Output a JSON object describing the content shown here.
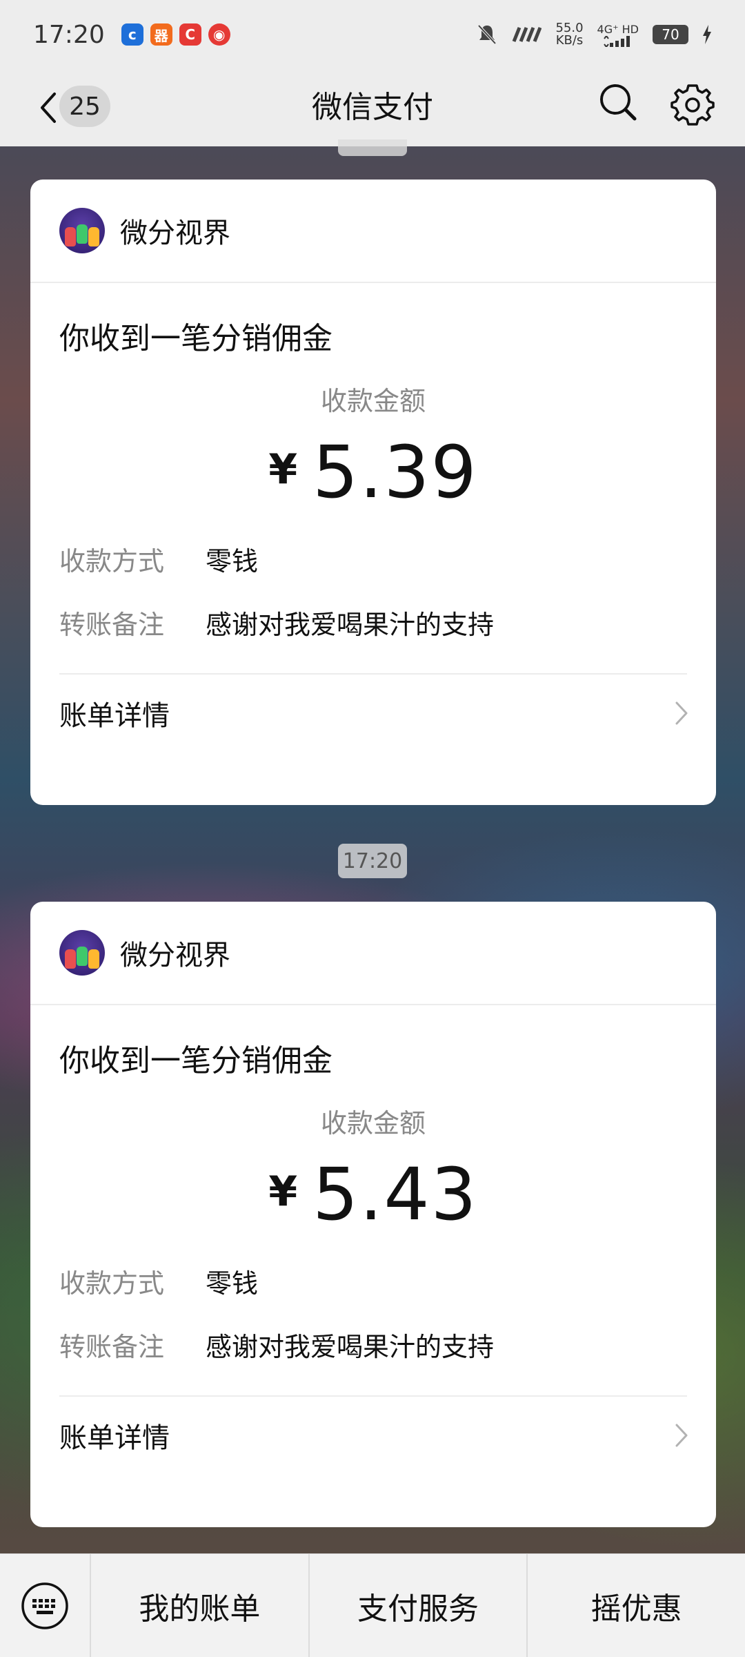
{
  "status_bar": {
    "time": "17:20",
    "net_speed": "55.0",
    "net_unit": "KB/s",
    "signal": "4G⁺ HD",
    "battery": "70"
  },
  "header": {
    "back_count": "25",
    "title": "微信支付"
  },
  "messages": [
    {
      "merchant": "微分视界",
      "title": "你收到一笔分销佣金",
      "amount_label": "收款金额",
      "currency": "¥",
      "amount": "5.39",
      "method_key": "收款方式",
      "method_value": "零钱",
      "note_key": "转账备注",
      "note_value": "感谢对我爱喝果汁的支持",
      "detail_label": "账单详情"
    },
    {
      "merchant": "微分视界",
      "title": "你收到一笔分销佣金",
      "amount_label": "收款金额",
      "currency": "¥",
      "amount": "5.43",
      "method_key": "收款方式",
      "method_value": "零钱",
      "note_key": "转账备注",
      "note_value": "感谢对我爱喝果汁的支持",
      "detail_label": "账单详情"
    }
  ],
  "timestamp": "17:20",
  "bottom_menu": {
    "keyboard_icon": "keyboard-icon",
    "items": [
      "我的账单",
      "支付服务",
      "摇优惠"
    ]
  },
  "colors": {
    "header_bg": "#ededed",
    "card_bg": "#ffffff",
    "muted_text": "#888888"
  }
}
